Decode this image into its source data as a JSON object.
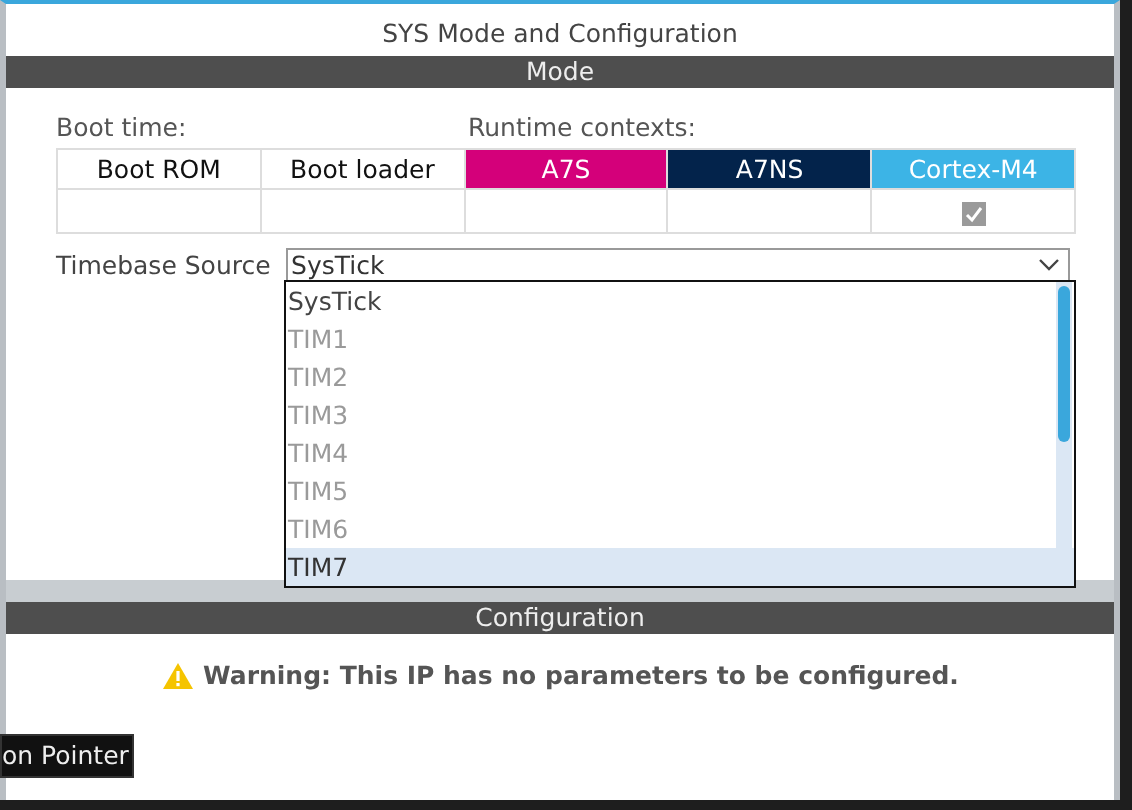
{
  "window": {
    "title": "SYS Mode and Configuration"
  },
  "mode": {
    "header": "Mode",
    "boot_label": "Boot time:",
    "runtime_label": "Runtime contexts:",
    "columns": [
      {
        "label": "Boot ROM",
        "kind": "plain"
      },
      {
        "label": "Boot loader",
        "kind": "plain"
      },
      {
        "label": "A7S",
        "kind": "context",
        "color": "#d4007a"
      },
      {
        "label": "A7NS",
        "kind": "context",
        "color": "#03234b"
      },
      {
        "label": "Cortex-M4",
        "kind": "checkbox",
        "color": "#3cb4e6",
        "checked": true
      }
    ],
    "timebase": {
      "label": "Timebase Source",
      "value": "SysTick"
    },
    "dropdown": [
      {
        "label": "SysTick",
        "disabled": false,
        "selected": false
      },
      {
        "label": "TIM1",
        "disabled": true,
        "selected": false
      },
      {
        "label": "TIM2",
        "disabled": true,
        "selected": false
      },
      {
        "label": "TIM3",
        "disabled": true,
        "selected": false
      },
      {
        "label": "TIM4",
        "disabled": true,
        "selected": false
      },
      {
        "label": "TIM5",
        "disabled": true,
        "selected": false
      },
      {
        "label": "TIM6",
        "disabled": true,
        "selected": false
      },
      {
        "label": "TIM7",
        "disabled": false,
        "selected": true
      }
    ]
  },
  "configuration": {
    "header": "Configuration",
    "warning": "Warning: This IP has no parameters to be configured."
  },
  "tooltip": "on Pointer"
}
